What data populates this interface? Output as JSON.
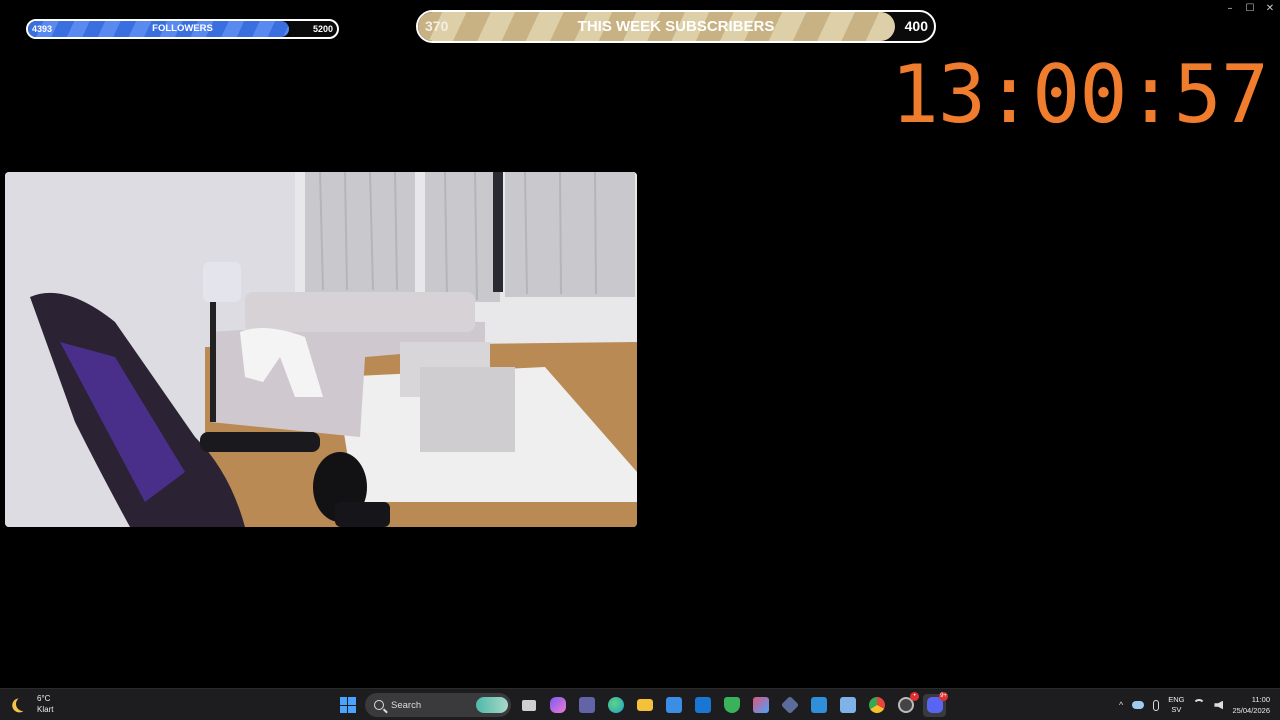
{
  "window": {
    "controls": {
      "minimize": "–",
      "maximize": "☐",
      "close": "✕"
    }
  },
  "followers_bar": {
    "current": "4393",
    "label": "FOLLOWERS",
    "goal": "5200",
    "progress_fraction": 0.845,
    "color": "#3a6fe0"
  },
  "subscribers_bar": {
    "current": "370",
    "label": "THIS WEEK SUBSCRIBERS",
    "goal": "400",
    "progress_fraction": 0.925,
    "color": "#c8b283"
  },
  "timer": {
    "value": "13:00:57",
    "color": "#f07c2e"
  },
  "webcam": {
    "description_icon": "webcam-feed"
  },
  "taskbar": {
    "weather": {
      "temp": "6°C",
      "condition": "Klart",
      "icon": "moon-icon"
    },
    "search": {
      "placeholder": "Search"
    },
    "apps": [
      {
        "name": "start",
        "icon": "windows-start-icon"
      },
      {
        "name": "task-view",
        "icon": "task-view-icon",
        "color": "#cfcfcf"
      },
      {
        "name": "copilot",
        "icon": "copilot-icon",
        "color": "#7b5cf0"
      },
      {
        "name": "teams",
        "icon": "teams-icon",
        "color": "#6264a7"
      },
      {
        "name": "edge",
        "icon": "edge-icon",
        "color": "#1fa0d8"
      },
      {
        "name": "file-explorer",
        "icon": "folder-icon",
        "color": "#f3c13a"
      },
      {
        "name": "store",
        "icon": "store-icon",
        "color": "#3a8ee6"
      },
      {
        "name": "outlook",
        "icon": "outlook-icon",
        "color": "#1976d2"
      },
      {
        "name": "vpn",
        "icon": "shield-app-icon",
        "color": "#3ab15b"
      },
      {
        "name": "m365",
        "icon": "m365-icon",
        "color": "#e0567a"
      },
      {
        "name": "app-hex",
        "icon": "hex-app-icon",
        "color": "#5b6b9a"
      },
      {
        "name": "photos",
        "icon": "photos-icon",
        "color": "#2f8fd8"
      },
      {
        "name": "snip",
        "icon": "snipping-icon",
        "color": "#7fb3e8"
      },
      {
        "name": "chrome",
        "icon": "chrome-icon",
        "color": "#e8453c"
      },
      {
        "name": "obs",
        "icon": "obs-icon",
        "color": "#444444",
        "badge": "•"
      },
      {
        "name": "discord",
        "icon": "discord-icon",
        "color": "#5865f2",
        "badge": "9+"
      }
    ],
    "tray": {
      "chevron": "^",
      "lang_top": "ENG",
      "lang_bottom": "SV",
      "time": "11:00",
      "date": "25/04/2026"
    }
  }
}
